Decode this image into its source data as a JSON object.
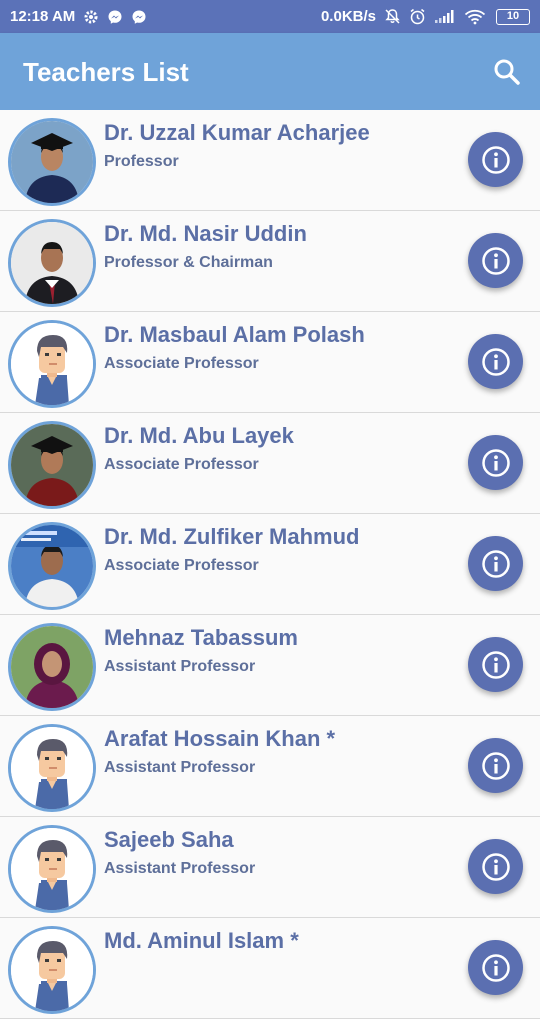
{
  "status_bar": {
    "time": "12:18 AM",
    "speed": "0.0KB/s",
    "battery": "10",
    "left_icons": [
      "gear-icon",
      "messenger-icon",
      "messenger-icon"
    ],
    "right_icons": [
      "bell-off-icon",
      "alarm-icon",
      "signal-icon",
      "wifi-icon",
      "battery-icon"
    ]
  },
  "app_bar": {
    "title": "Teachers List",
    "action_icon": "search-icon"
  },
  "teachers": [
    {
      "name": "Dr. Uzzal Kumar Acharjee",
      "designation": "Professor",
      "avatar": "photo-graduation"
    },
    {
      "name": "Dr. Md. Nasir Uddin",
      "designation": "Professor & Chairman",
      "avatar": "photo-suit"
    },
    {
      "name": "Dr. Masbaul Alam Polash",
      "designation": "Associate Professor",
      "avatar": "placeholder-avatar"
    },
    {
      "name": "Dr. Md. Abu Layek",
      "designation": "Associate Professor",
      "avatar": "photo-graduation-gown"
    },
    {
      "name": "Dr. Md. Zulfiker Mahmud",
      "designation": "Associate Professor",
      "avatar": "photo-conference"
    },
    {
      "name": "Mehnaz Tabassum",
      "designation": "Assistant Professor",
      "avatar": "photo-hijab"
    },
    {
      "name": "Arafat Hossain Khan *",
      "designation": "Assistant Professor",
      "avatar": "placeholder-avatar"
    },
    {
      "name": "Sajeeb Saha",
      "designation": "Assistant Professor",
      "avatar": "placeholder-avatar"
    },
    {
      "name": "Md. Aminul Islam *",
      "designation": "",
      "avatar": "placeholder-avatar"
    }
  ],
  "colors": {
    "status_bar": "#5b72b8",
    "app_bar": "#6fa3d9",
    "name_text": "#5b6fa6",
    "role_text": "#5e6f99",
    "info_button": "#5b6fb1",
    "avatar_border": "#6fa3d9"
  }
}
